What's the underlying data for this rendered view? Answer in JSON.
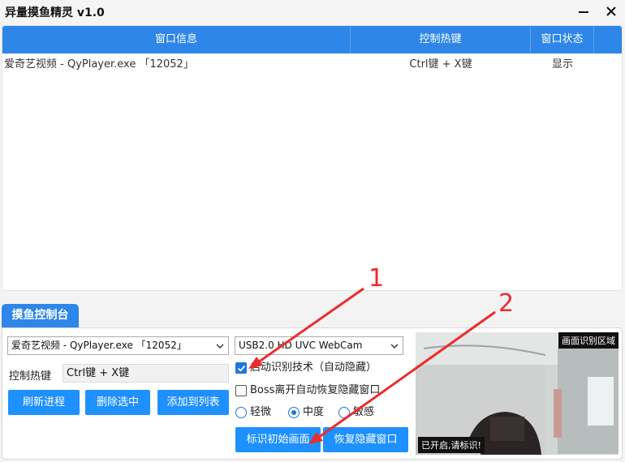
{
  "window": {
    "title": "异量摸鱼精灵 v1.0"
  },
  "table": {
    "headers": [
      "窗口信息",
      "控制热键",
      "窗口状态"
    ],
    "rows": [
      {
        "info": "爱奇艺视频 - QyPlayer.exe 「12052」",
        "hotkey": "Ctrl键 + X键",
        "status": "显示"
      }
    ]
  },
  "control": {
    "tab_label": "摸鱼控制台",
    "process_select": "爱奇艺视频 - QyPlayer.exe 「12052」",
    "hotkey_label": "控制热键",
    "hotkey_value": "Ctrl键 + X键",
    "buttons": {
      "refresh": "刷新进程",
      "delete": "删除选中",
      "add": "添加到列表",
      "init_frame": "标识初始画面",
      "restore": "恢复隐藏窗口"
    },
    "camera_select": "USB2.0 HD UVC WebCam",
    "options": {
      "enable_recognition": {
        "label": "启动识别技术（自动隐藏）",
        "checked": true
      },
      "boss_auto_restore": {
        "label": "Boss离开自动恢复隐藏窗口",
        "checked": false
      }
    },
    "sensitivity": {
      "options": [
        "轻微",
        "中度",
        "敏感"
      ],
      "selected": "中度"
    },
    "camera": {
      "area_label": "画面识别区域",
      "status_label": "已开启,请标识!"
    }
  },
  "annotations": {
    "num1": "1",
    "num2": "2",
    "color": "#ee2b2b"
  },
  "colors": {
    "accent": "#2e86e8",
    "button": "#1e90ff"
  }
}
